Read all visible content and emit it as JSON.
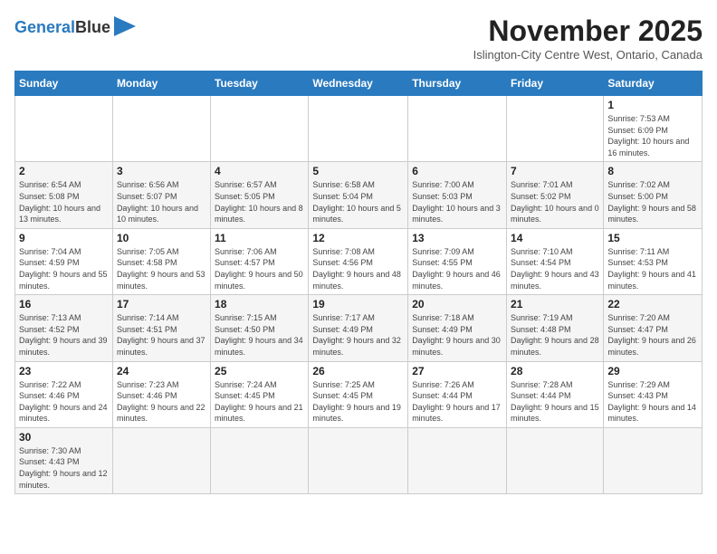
{
  "header": {
    "logo_line1": "General",
    "logo_line2": "Blue",
    "title": "November 2025",
    "subtitle": "Islington-City Centre West, Ontario, Canada"
  },
  "days_of_week": [
    "Sunday",
    "Monday",
    "Tuesday",
    "Wednesday",
    "Thursday",
    "Friday",
    "Saturday"
  ],
  "weeks": [
    [
      {
        "num": "",
        "info": ""
      },
      {
        "num": "",
        "info": ""
      },
      {
        "num": "",
        "info": ""
      },
      {
        "num": "",
        "info": ""
      },
      {
        "num": "",
        "info": ""
      },
      {
        "num": "",
        "info": ""
      },
      {
        "num": "1",
        "info": "Sunrise: 7:53 AM\nSunset: 6:09 PM\nDaylight: 10 hours and 16 minutes."
      }
    ],
    [
      {
        "num": "2",
        "info": "Sunrise: 6:54 AM\nSunset: 5:08 PM\nDaylight: 10 hours and 13 minutes."
      },
      {
        "num": "3",
        "info": "Sunrise: 6:56 AM\nSunset: 5:07 PM\nDaylight: 10 hours and 10 minutes."
      },
      {
        "num": "4",
        "info": "Sunrise: 6:57 AM\nSunset: 5:05 PM\nDaylight: 10 hours and 8 minutes."
      },
      {
        "num": "5",
        "info": "Sunrise: 6:58 AM\nSunset: 5:04 PM\nDaylight: 10 hours and 5 minutes."
      },
      {
        "num": "6",
        "info": "Sunrise: 7:00 AM\nSunset: 5:03 PM\nDaylight: 10 hours and 3 minutes."
      },
      {
        "num": "7",
        "info": "Sunrise: 7:01 AM\nSunset: 5:02 PM\nDaylight: 10 hours and 0 minutes."
      },
      {
        "num": "8",
        "info": "Sunrise: 7:02 AM\nSunset: 5:00 PM\nDaylight: 9 hours and 58 minutes."
      }
    ],
    [
      {
        "num": "9",
        "info": "Sunrise: 7:04 AM\nSunset: 4:59 PM\nDaylight: 9 hours and 55 minutes."
      },
      {
        "num": "10",
        "info": "Sunrise: 7:05 AM\nSunset: 4:58 PM\nDaylight: 9 hours and 53 minutes."
      },
      {
        "num": "11",
        "info": "Sunrise: 7:06 AM\nSunset: 4:57 PM\nDaylight: 9 hours and 50 minutes."
      },
      {
        "num": "12",
        "info": "Sunrise: 7:08 AM\nSunset: 4:56 PM\nDaylight: 9 hours and 48 minutes."
      },
      {
        "num": "13",
        "info": "Sunrise: 7:09 AM\nSunset: 4:55 PM\nDaylight: 9 hours and 46 minutes."
      },
      {
        "num": "14",
        "info": "Sunrise: 7:10 AM\nSunset: 4:54 PM\nDaylight: 9 hours and 43 minutes."
      },
      {
        "num": "15",
        "info": "Sunrise: 7:11 AM\nSunset: 4:53 PM\nDaylight: 9 hours and 41 minutes."
      }
    ],
    [
      {
        "num": "16",
        "info": "Sunrise: 7:13 AM\nSunset: 4:52 PM\nDaylight: 9 hours and 39 minutes."
      },
      {
        "num": "17",
        "info": "Sunrise: 7:14 AM\nSunset: 4:51 PM\nDaylight: 9 hours and 37 minutes."
      },
      {
        "num": "18",
        "info": "Sunrise: 7:15 AM\nSunset: 4:50 PM\nDaylight: 9 hours and 34 minutes."
      },
      {
        "num": "19",
        "info": "Sunrise: 7:17 AM\nSunset: 4:49 PM\nDaylight: 9 hours and 32 minutes."
      },
      {
        "num": "20",
        "info": "Sunrise: 7:18 AM\nSunset: 4:49 PM\nDaylight: 9 hours and 30 minutes."
      },
      {
        "num": "21",
        "info": "Sunrise: 7:19 AM\nSunset: 4:48 PM\nDaylight: 9 hours and 28 minutes."
      },
      {
        "num": "22",
        "info": "Sunrise: 7:20 AM\nSunset: 4:47 PM\nDaylight: 9 hours and 26 minutes."
      }
    ],
    [
      {
        "num": "23",
        "info": "Sunrise: 7:22 AM\nSunset: 4:46 PM\nDaylight: 9 hours and 24 minutes."
      },
      {
        "num": "24",
        "info": "Sunrise: 7:23 AM\nSunset: 4:46 PM\nDaylight: 9 hours and 22 minutes."
      },
      {
        "num": "25",
        "info": "Sunrise: 7:24 AM\nSunset: 4:45 PM\nDaylight: 9 hours and 21 minutes."
      },
      {
        "num": "26",
        "info": "Sunrise: 7:25 AM\nSunset: 4:45 PM\nDaylight: 9 hours and 19 minutes."
      },
      {
        "num": "27",
        "info": "Sunrise: 7:26 AM\nSunset: 4:44 PM\nDaylight: 9 hours and 17 minutes."
      },
      {
        "num": "28",
        "info": "Sunrise: 7:28 AM\nSunset: 4:44 PM\nDaylight: 9 hours and 15 minutes."
      },
      {
        "num": "29",
        "info": "Sunrise: 7:29 AM\nSunset: 4:43 PM\nDaylight: 9 hours and 14 minutes."
      }
    ],
    [
      {
        "num": "30",
        "info": "Sunrise: 7:30 AM\nSunset: 4:43 PM\nDaylight: 9 hours and 12 minutes."
      },
      {
        "num": "",
        "info": ""
      },
      {
        "num": "",
        "info": ""
      },
      {
        "num": "",
        "info": ""
      },
      {
        "num": "",
        "info": ""
      },
      {
        "num": "",
        "info": ""
      },
      {
        "num": "",
        "info": ""
      }
    ]
  ]
}
